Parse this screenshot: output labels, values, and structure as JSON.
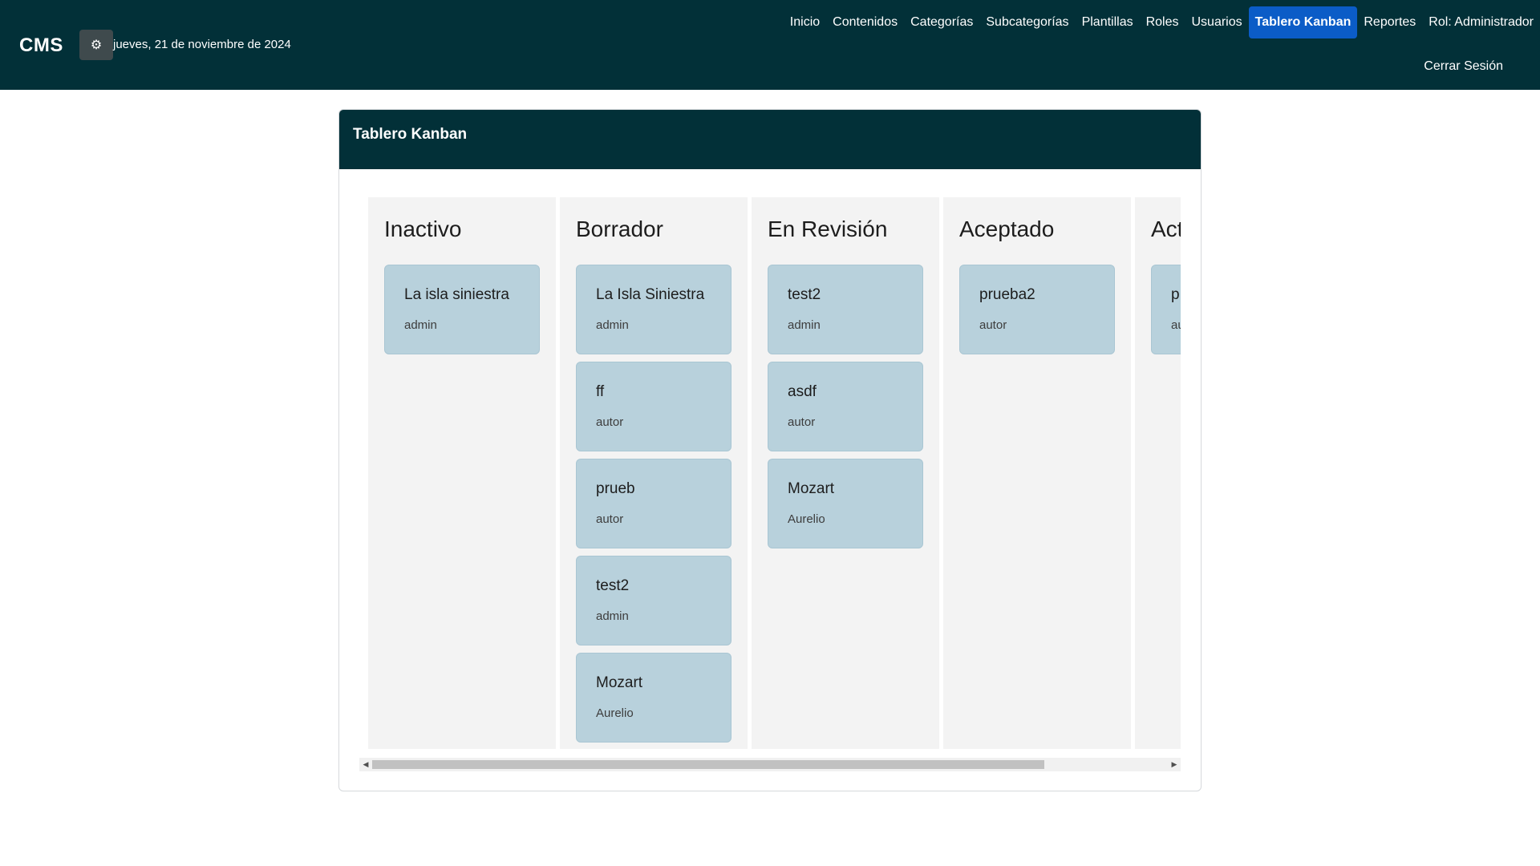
{
  "navbar": {
    "brand": "CMS",
    "theme_icon": "gear-icon",
    "date": "jueves, 21 de noviembre de 2024",
    "links": [
      {
        "label": "Inicio"
      },
      {
        "label": "Contenidos"
      },
      {
        "label": "Categorías"
      },
      {
        "label": "Subcategorías"
      },
      {
        "label": "Plantillas"
      },
      {
        "label": "Roles"
      },
      {
        "label": "Usuarios"
      },
      {
        "label": "Tablero Kanban",
        "active": true
      },
      {
        "label": "Reportes"
      },
      {
        "label": "Rol: Administrador"
      }
    ],
    "logout": "Cerrar Sesión"
  },
  "card": {
    "title": "Tablero Kanban"
  },
  "board": {
    "columns": [
      {
        "title": "Inactivo",
        "cards": [
          {
            "title": "La isla siniestra",
            "author": "admin"
          }
        ]
      },
      {
        "title": "Borrador",
        "cards": [
          {
            "title": "La Isla Siniestra",
            "author": "admin"
          },
          {
            "title": "ff",
            "author": "autor"
          },
          {
            "title": "prueb",
            "author": "autor"
          },
          {
            "title": "test2",
            "author": "admin"
          },
          {
            "title": "Mozart",
            "author": "Aurelio"
          }
        ]
      },
      {
        "title": "En Revisión",
        "cards": [
          {
            "title": "test2",
            "author": "admin"
          },
          {
            "title": "asdf",
            "author": "autor"
          },
          {
            "title": "Mozart",
            "author": "Aurelio"
          }
        ]
      },
      {
        "title": "Aceptado",
        "cards": [
          {
            "title": "prueba2",
            "author": "autor"
          }
        ]
      },
      {
        "title": "Act",
        "cards": [
          {
            "title": "p",
            "author": "au"
          }
        ]
      }
    ]
  },
  "colors": {
    "navbar_bg": "#023038",
    "active_link_bg": "#0b5cc7",
    "column_bg": "#f3f3f3",
    "card_bg": "#b8d1dc"
  }
}
